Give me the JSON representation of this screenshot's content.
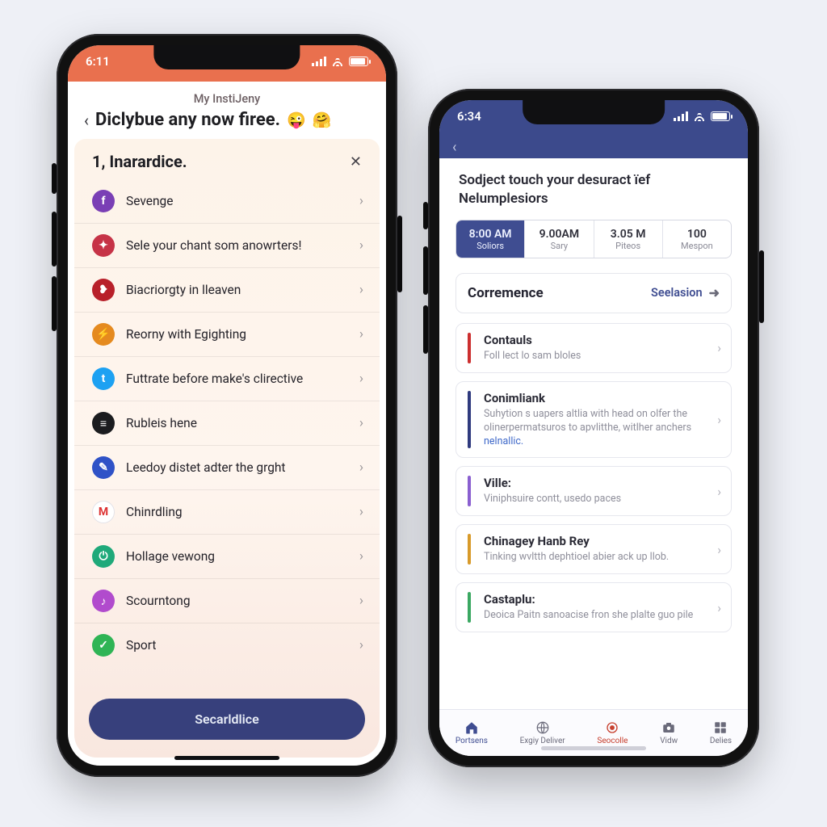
{
  "phone1": {
    "status_time": "6:11",
    "close_x": "✕",
    "breadcrumb": "My InstiJeny",
    "title": "Diclybue any now firee.",
    "emoji1": "😜",
    "emoji2": "🤗",
    "card_title": "1, Inarardice.",
    "card_close": "✕",
    "items": [
      {
        "label": "Sevenge",
        "icon_bg": "#7a3fb5",
        "icon_glyph": "f",
        "icon_name": "facebook-icon"
      },
      {
        "label": "Sele your chant som anowrters!",
        "icon_bg": "#c63347",
        "icon_glyph": "✦",
        "icon_name": "spark-icon"
      },
      {
        "label": "Biacriorgty in lleaven",
        "icon_bg": "#b8202a",
        "icon_glyph": "❥",
        "icon_name": "leaf-icon"
      },
      {
        "label": "Reorny with Egighting",
        "icon_bg": "#e58a1f",
        "icon_glyph": "⚡",
        "icon_name": "bolt-icon"
      },
      {
        "label": "Futtrate before make's clirective",
        "icon_bg": "#1da1f2",
        "icon_glyph": "t",
        "icon_name": "twitter-icon"
      },
      {
        "label": "Rubleis hene",
        "icon_bg": "#1b1c1f",
        "icon_glyph": "≡",
        "icon_name": "bars-icon"
      },
      {
        "label": "Leedoy distet adter the grght",
        "icon_bg": "#2f52c7",
        "icon_glyph": "✎",
        "icon_name": "pencil-icon"
      },
      {
        "label": "Chinrdling",
        "icon_bg": "#ffffff",
        "icon_glyph": "M",
        "icon_name": "mail-icon"
      },
      {
        "label": "Hollage vewong",
        "icon_bg": "#1fa97a",
        "icon_glyph": "⏻",
        "icon_name": "power-icon"
      },
      {
        "label": "Scourntong",
        "icon_bg": "#b14bcd",
        "icon_glyph": "♪",
        "icon_name": "music-icon"
      },
      {
        "label": "Sport",
        "icon_bg": "#2fb455",
        "icon_glyph": "✓",
        "icon_name": "check-icon"
      }
    ],
    "cta": "Secarldlice"
  },
  "phone2": {
    "status_time": "6:34",
    "headline": "Sodject touch your desuract їef Nelumplesiors",
    "segments": [
      {
        "value": "8:00 AM",
        "label": "Soliors",
        "active": true
      },
      {
        "value": "9.00AM",
        "label": "Sary",
        "active": false
      },
      {
        "value": "3.05 M",
        "label": "Piteos",
        "active": false
      },
      {
        "value": "100",
        "label": "Mespon",
        "active": false
      }
    ],
    "section": {
      "title": "Corremence",
      "action": "Seelasion"
    },
    "feed": [
      {
        "stripe": "#cc2f2f",
        "title": "Contauls",
        "sub": "Foll lect lo sam bloles"
      },
      {
        "stripe": "#2f3a7e",
        "title": "Conimliank",
        "sub": "Suhytion s uapers altlia with head on olfer the olinerpermatsuros to apvlitthe, witlher anchers",
        "link": "nelnallic."
      },
      {
        "stripe": "#8a5fd0",
        "title": "Ville:",
        "sub": "Viniphsuire contt, usedo paces"
      },
      {
        "stripe": "#d89a2a",
        "title": "Chinagey Hanb Rey",
        "sub": "Tinking wvltth dephtioel abier ack up llob."
      },
      {
        "stripe": "#3ba862",
        "title": "Castaplu:",
        "sub": "Deoica Paitn sanoacise fron she plalte guo pile"
      }
    ],
    "tabs": [
      {
        "label": "Portsens",
        "icon": "home-icon",
        "tone": "home"
      },
      {
        "label": "Exgiy Deliver",
        "icon": "globe-icon"
      },
      {
        "label": "Seocolle",
        "icon": "target-icon",
        "tone": "active"
      },
      {
        "label": "Vidw",
        "icon": "camera-icon"
      },
      {
        "label": "Delies",
        "icon": "grid-icon"
      }
    ]
  },
  "glyph": {
    "back": "‹",
    "chevron": "›",
    "plane": "➜"
  }
}
